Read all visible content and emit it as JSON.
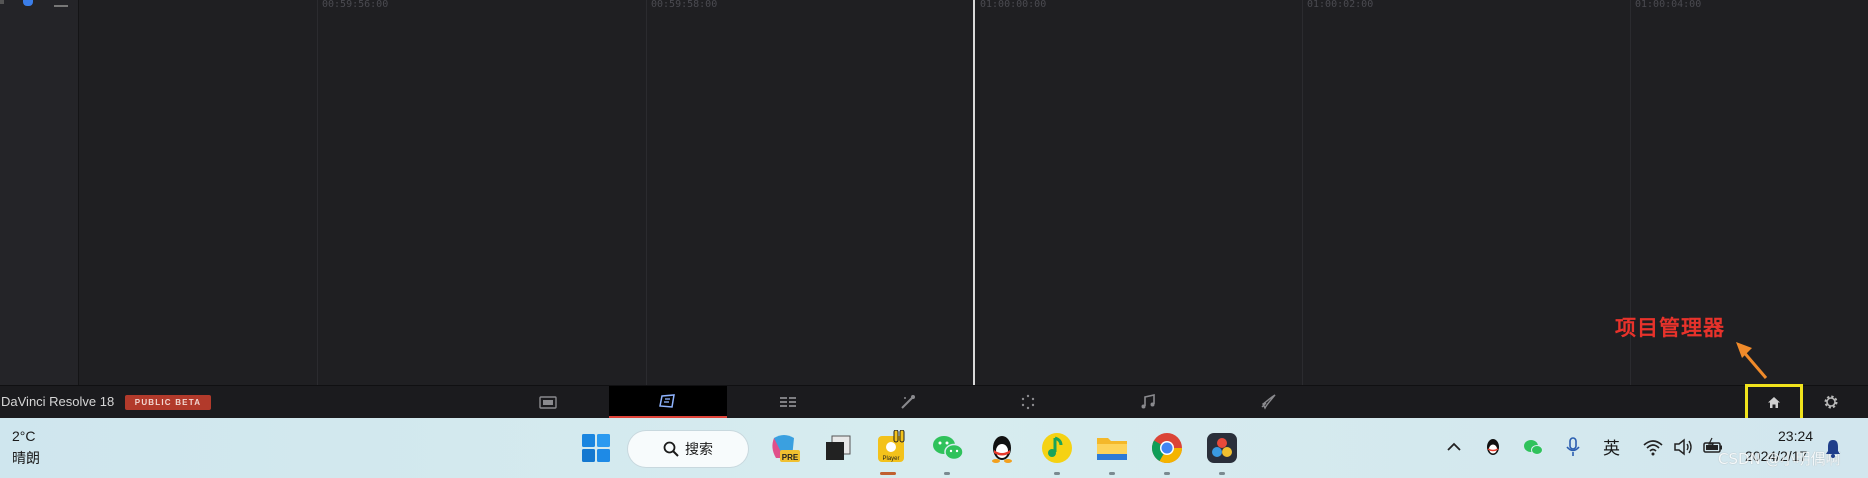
{
  "timeline": {
    "timecodes": [
      "00:59:56:00",
      "00:59:58:00",
      "01:00:00:00",
      "01:00:02:00",
      "01:00:04:00"
    ]
  },
  "annotation": {
    "text": "项目管理器",
    "color": "#e8322b",
    "arrow_color": "#f08a2a",
    "highlight_color": "#f0e31c"
  },
  "resolve_bar": {
    "app_title": "DaVinci Resolve 18",
    "badge": "PUBLIC BETA",
    "accent": "#e0443a",
    "pages": [
      {
        "name": "media",
        "icon": "media-page-icon",
        "active": false
      },
      {
        "name": "cut",
        "icon": "cut-page-icon",
        "active": true
      },
      {
        "name": "edit",
        "icon": "edit-page-icon",
        "active": false
      },
      {
        "name": "fusion",
        "icon": "fusion-page-icon",
        "active": false
      },
      {
        "name": "color",
        "icon": "color-page-icon",
        "active": false
      },
      {
        "name": "fairlight",
        "icon": "fairlight-page-icon",
        "active": false
      },
      {
        "name": "deliver",
        "icon": "deliver-page-icon",
        "active": false
      }
    ],
    "home_icon": "home-icon",
    "settings_icon": "gear-icon"
  },
  "taskbar": {
    "weather": {
      "temp": "2°C",
      "desc": "晴朗"
    },
    "search_label": "搜索",
    "apps": [
      "windows-start-icon",
      "copilot-pre-icon",
      "task-view-icon",
      "player-app-icon",
      "wechat-icon",
      "qq-icon",
      "qq-music-icon",
      "file-explorer-icon",
      "chrome-icon",
      "davinci-resolve-icon"
    ],
    "tray": {
      "ime": "英"
    },
    "clock": {
      "time": "23:24",
      "date": "2024/2/17"
    },
    "watermark": "CSDN @小明偶啊"
  }
}
